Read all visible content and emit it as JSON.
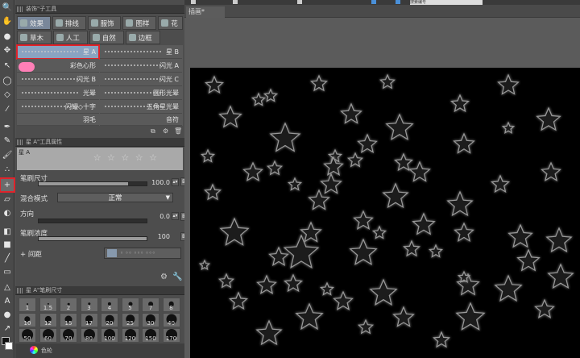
{
  "colors": {
    "highlight": "#e0232b",
    "selected_tab": "#79879a",
    "selected_brush": "#8aa3c1",
    "canvas": "#000000"
  },
  "toolbar": {
    "tools": [
      "magnifier-icon",
      "hand-icon",
      "zoom-red-icon",
      "move-icon",
      "operation-icon",
      "lasso-icon",
      "selection-icon",
      "eyedropper-icon",
      "pen-icon",
      "pencil-icon",
      "brush-icon",
      "airbrush-icon",
      "decoration-icon",
      "eraser-icon",
      "fill-icon",
      "gradient-icon",
      "figure-icon",
      "frame-icon",
      "ruler-icon",
      "text-icon",
      "balloon-icon",
      "correction-icon"
    ]
  },
  "sub_tool_panel": {
    "title": "装饰\"子工具",
    "tabs_row1": [
      "效果",
      "排线",
      "服饰",
      "图样",
      "花"
    ],
    "tabs_row2": [
      "草木",
      "人工",
      "自然",
      "边框"
    ],
    "brushes": [
      [
        "星 A",
        "星 B"
      ],
      [
        "彩色心形",
        "闪光 A"
      ],
      [
        "闪光 B",
        "闪光 C"
      ],
      [
        "光晕",
        "圆形光晕"
      ],
      [
        "闪耀◇十字",
        "五角星光晕"
      ],
      [
        "羽毛",
        "音符"
      ]
    ]
  },
  "tool_property": {
    "title": "星 A\"工具属性",
    "preview_name": "星 A",
    "brush_size_label": "笔刷尺寸",
    "brush_size_value": "100.0",
    "brush_size_fraction": 0.83,
    "blend_label": "混合模式",
    "blend_value": "正常",
    "direction_label": "方向",
    "direction_value": "0.0",
    "density_label": "笔刷浓度",
    "density_value": "100",
    "spacing_label": "+ 间距"
  },
  "brush_size_panel": {
    "title": "星 A\"笔刷尺寸",
    "sizes": [
      "1",
      "1.5",
      "2",
      "3",
      "4",
      "5",
      "7",
      "8",
      "10",
      "12",
      "15",
      "17",
      "20",
      "25",
      "30",
      "40",
      "50",
      "60",
      "70",
      "80",
      "100",
      "120",
      "150",
      "170"
    ]
  },
  "color_tab": "色轮",
  "document": {
    "tab_title": "插画*",
    "search_text": "搜索编号"
  }
}
